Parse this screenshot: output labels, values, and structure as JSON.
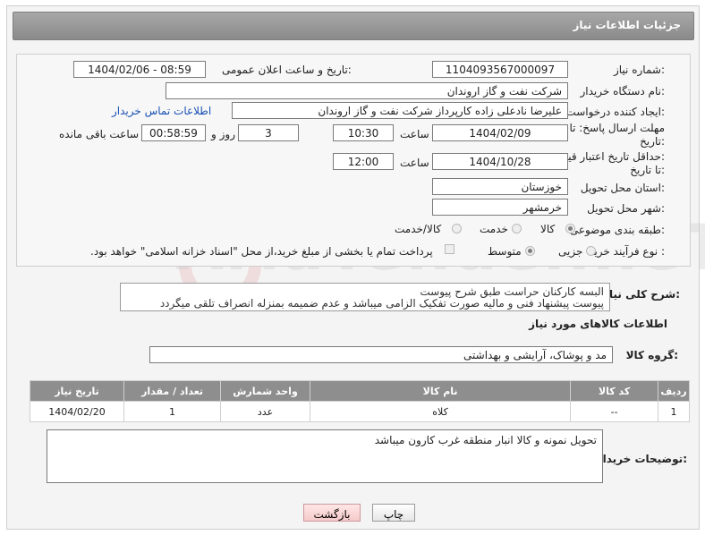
{
  "header": {
    "title": "جزئیات اطلاعات نیاز"
  },
  "form": {
    "need_number_label": "شماره نیاز:",
    "need_number": "1104093567000097",
    "announce_label": "تاریخ و ساعت اعلان عمومی:",
    "announce_value": "1404/02/06 - 08:59",
    "buyer_label": "نام دستگاه خریدار:",
    "buyer_value": "شرکت نفت و گاز اروندان",
    "creator_label": "ایجاد کننده درخواست:",
    "creator_value": "علیرضا نادعلی زاده کارپرداز شرکت نفت و گاز اروندان",
    "contact_link": "اطلاعات تماس خریدار",
    "deadline_label_1": "مهلت ارسال پاسخ: تا",
    "deadline_label_2": "تاریخ:",
    "deadline_date": "1404/02/09",
    "time_label": "ساعت",
    "deadline_time": "10:30",
    "days_value": "3",
    "days_label": "روز و",
    "remaining_time": "00:58:59",
    "remaining_label": "ساعت باقی مانده",
    "validity_label_1": "حداقل تاریخ اعتبار قیمت:",
    "validity_label_2": "تا تاریخ:",
    "validity_date": "1404/10/28",
    "validity_time": "12:00",
    "province_label": "استان محل تحویل:",
    "province_value": "خوزستان",
    "city_label": "شهر محل تحویل:",
    "city_value": "خرمشهر",
    "category_label": "طبقه بندی موضوعی:",
    "category_options": [
      "کالا",
      "خدمت",
      "کالا/خدمت"
    ],
    "process_label": "نوع فرآیند خرید :",
    "process_options": [
      "جزیی",
      "متوسط"
    ],
    "payment_note": "پرداخت تمام یا بخشی از مبلغ خرید،از محل \"اسناد خزانه اسلامی\" خواهد بود."
  },
  "description": {
    "label": "شرح کلی نیاز:",
    "line1": "البسه کارکنان حراست طبق شرح پیوست",
    "line2": "پیوست پیشنهاد فنی و مالیه صورت تفکیک  الزامی میباشد و عدم ضمیمه بمنزله انصراف تلقی میگردد"
  },
  "goods": {
    "section_title": "اطلاعات کالاهای مورد نیاز",
    "group_label": "گروه کالا:",
    "group_value": "مد و پوشاک، آرایشی و بهداشتی",
    "columns": [
      "ردیف",
      "کد کالا",
      "نام کالا",
      "واحد شمارش",
      "تعداد / مقدار",
      "تاریخ نیاز"
    ],
    "rows": [
      [
        "1",
        "--",
        "کلاه",
        "عدد",
        "1",
        "1404/02/20"
      ]
    ]
  },
  "notes": {
    "label": "توضیحات خریدار:",
    "value": "تحویل نمونه و کالا انبار منطقه غرب کارون میباشد"
  },
  "buttons": {
    "print": "چاپ",
    "back": "بازگشت"
  },
  "watermark": {
    "text": "AriaTender.neT"
  }
}
